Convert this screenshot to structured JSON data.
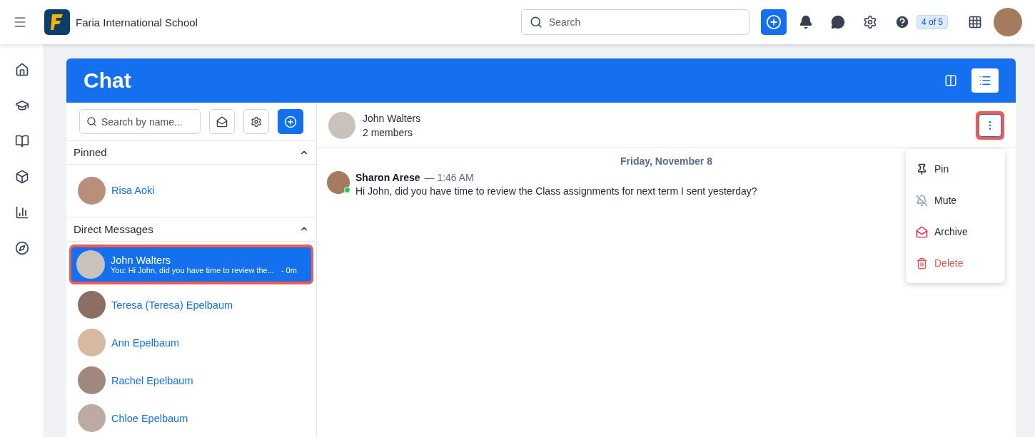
{
  "topbar": {
    "school": "Faria International School",
    "search": {
      "placeholder": "Search"
    },
    "help_badge": "4 of 5"
  },
  "page": {
    "title": "Chat",
    "views": [
      {
        "kind": "columns",
        "selected": false
      },
      {
        "kind": "list",
        "selected": true
      }
    ]
  },
  "chat_list": {
    "search": {
      "placeholder": "Search by name..."
    },
    "sections": [
      {
        "title": "Pinned",
        "expanded": true,
        "items": [
          {
            "name": "Risa Aoki",
            "selected": false,
            "highlighted": false
          }
        ]
      },
      {
        "title": "Direct Messages",
        "expanded": true,
        "items": [
          {
            "name": "John Walters",
            "preview": "You: Hi John, did you have time to review the...",
            "time": "- 0m",
            "selected": true,
            "highlighted": true
          },
          {
            "name": "Teresa (Teresa) Epelbaum",
            "selected": false,
            "highlighted": false
          },
          {
            "name": "Ann Epelbaum",
            "selected": false,
            "highlighted": false
          },
          {
            "name": "Rachel Epelbaum",
            "selected": false,
            "highlighted": false
          },
          {
            "name": "Chloe Epelbaum",
            "selected": false,
            "highlighted": false
          }
        ]
      }
    ]
  },
  "conversation": {
    "name": "John Walters",
    "members": "2 members",
    "more_highlighted": true,
    "date": "Friday, November 8",
    "messages": [
      {
        "author": "Sharon Arese",
        "time": "— 1:46 AM",
        "online": true,
        "text": "Hi John, did you have time to review the Class assignments for next term I sent yesterday?"
      }
    ],
    "menu": [
      {
        "kind": "pin",
        "label": "Pin"
      },
      {
        "kind": "mute",
        "label": "Mute"
      },
      {
        "kind": "archive",
        "label": "Archive"
      },
      {
        "kind": "delete",
        "label": "Delete"
      }
    ]
  }
}
